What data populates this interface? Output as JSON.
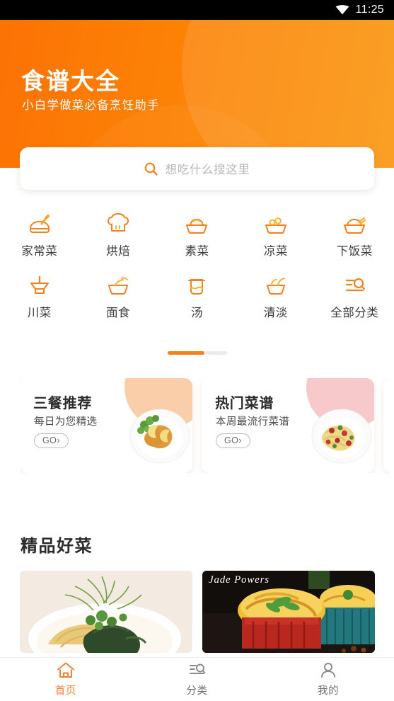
{
  "status_bar": {
    "time": "11:25",
    "wifi_icon": "wifi-icon",
    "background": "#000000"
  },
  "header": {
    "title": "食谱大全",
    "subtitle": "小白学做菜必备烹饪助手",
    "gradient_from": "#fb7205",
    "gradient_to": "#fa940c"
  },
  "search": {
    "placeholder": "想吃什么搜这里",
    "icon": "search-icon",
    "icon_color": "#f2811e"
  },
  "categories": {
    "items": [
      {
        "label": "家常菜",
        "icon": "wok-pan-icon"
      },
      {
        "label": "烘焙",
        "icon": "chef-hat-icon"
      },
      {
        "label": "素菜",
        "icon": "vegetable-bowl-icon"
      },
      {
        "label": "凉菜",
        "icon": "cold-dish-bowl-icon"
      },
      {
        "label": "下饭菜",
        "icon": "rice-bowl-chopsticks-icon"
      },
      {
        "label": "川菜",
        "icon": "mortar-pestle-icon"
      },
      {
        "label": "面食",
        "icon": "noodle-bowl-icon"
      },
      {
        "label": "汤",
        "icon": "soup-pot-icon"
      },
      {
        "label": "清淡",
        "icon": "light-food-bowl-icon"
      },
      {
        "label": "全部分类",
        "icon": "category-list-search-icon"
      }
    ],
    "pagination": {
      "active_index": 0,
      "pages": 2,
      "active_color": "#f4811f",
      "inactive_color": "#ebebeb"
    }
  },
  "promos": [
    {
      "title": "三餐推荐",
      "subtitle": "每日为您精选",
      "go_label": "GO›",
      "blob_color": "#fbceaa",
      "food": "fried-cutlet-plate"
    },
    {
      "title": "热门菜谱",
      "subtitle": "本周最流行菜谱",
      "go_label": "GO›",
      "blob_color": "#f8c9cb",
      "food": "pasta-plate"
    },
    {
      "title": "",
      "subtitle": "",
      "go_label": "",
      "blob_color": "#ffd9b0",
      "food": ""
    }
  ],
  "featured": {
    "section_title": "精品好菜",
    "dishes": [
      {
        "name": "fish-noodle-dish",
        "watermark": ""
      },
      {
        "name": "baked-cheese-ramekins",
        "watermark": "Jade Powers"
      }
    ]
  },
  "tabbar": {
    "items": [
      {
        "label": "首页",
        "icon": "home-icon",
        "active": true
      },
      {
        "label": "分类",
        "icon": "category-list-icon",
        "active": false
      },
      {
        "label": "我的",
        "icon": "user-person-icon",
        "active": false
      }
    ],
    "active_color": "#ef8030",
    "idle_color": "#6f6f6f"
  }
}
